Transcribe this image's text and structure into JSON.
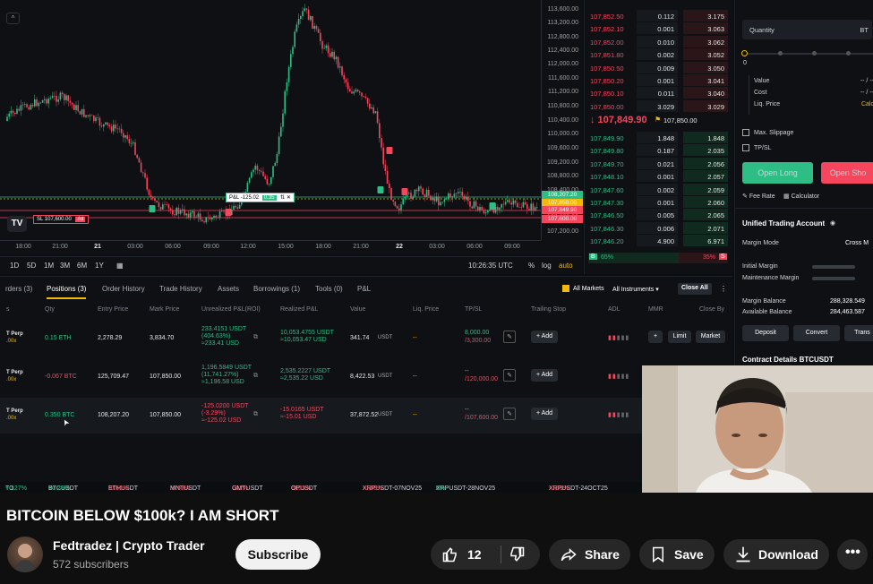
{
  "chart": {
    "y_ticks": [
      "113,600.00",
      "113,200.00",
      "112,800.00",
      "112,400.00",
      "112,000.00",
      "111,600.00",
      "111,200.00",
      "110,800.00",
      "110,400.00",
      "110,000.00",
      "109,600.00",
      "109,200.00",
      "108,800.00",
      "108,400.00",
      "107,600.00",
      "107,200.00"
    ],
    "price_tags": [
      "108,207.20",
      "107,850.00",
      "107,849.90",
      "107,600.00"
    ],
    "x_ticks": [
      "18:00",
      "21:00",
      "21",
      "03:00",
      "06:00",
      "09:00",
      "12:00",
      "15:00",
      "18:00",
      "21:00",
      "22",
      "03:00",
      "06:00",
      "09:00"
    ],
    "sl_label": "SL 107,600.00",
    "sl_all": "All",
    "pnl_label": "P&L -125.02",
    "pnl_qty": "0.35",
    "timeframes": [
      "1D",
      "5D",
      "1M",
      "3M",
      "6M",
      "1Y"
    ],
    "clock": "10:26:35 UTC",
    "opts": [
      "%",
      "log",
      "auto"
    ]
  },
  "orderbook": {
    "asks": [
      {
        "p": "107,852.50",
        "q": "0.112",
        "t": "3.175"
      },
      {
        "p": "107,852.10",
        "q": "0.001",
        "t": "3.063"
      },
      {
        "p": "107,852.00",
        "q": "0.010",
        "t": "3.062"
      },
      {
        "p": "107,851.80",
        "q": "0.002",
        "t": "3.052"
      },
      {
        "p": "107,850.50",
        "q": "0.009",
        "t": "3.050"
      },
      {
        "p": "107,850.20",
        "q": "0.001",
        "t": "3.041"
      },
      {
        "p": "107,850.10",
        "q": "0.011",
        "t": "3.040"
      },
      {
        "p": "107,850.00",
        "q": "3.029",
        "t": "3.029"
      }
    ],
    "mid_price": "↓ 107,849.90",
    "mark": "107,850.00",
    "bids": [
      {
        "p": "107,849.90",
        "q": "1.848",
        "t": "1.848"
      },
      {
        "p": "107,849.80",
        "q": "0.187",
        "t": "2.035"
      },
      {
        "p": "107,849.70",
        "q": "0.021",
        "t": "2.056"
      },
      {
        "p": "107,848.10",
        "q": "0.001",
        "t": "2.057"
      },
      {
        "p": "107,847.60",
        "q": "0.002",
        "t": "2.059"
      },
      {
        "p": "107,847.30",
        "q": "0.001",
        "t": "2.060"
      },
      {
        "p": "107,846.50",
        "q": "0.005",
        "t": "2.065"
      },
      {
        "p": "107,846.30",
        "q": "0.006",
        "t": "2.071"
      },
      {
        "p": "107,846.20",
        "q": "4.900",
        "t": "6.971"
      }
    ],
    "buy_pct": "65%",
    "sell_pct": "35%"
  },
  "trade": {
    "quantity_label": "Quantity",
    "quantity_unit": "BT",
    "slider_val": "0",
    "value_label": "Value",
    "value_val": "-- / --",
    "cost_label": "Cost",
    "cost_val": "-- / --",
    "liq_label": "Liq. Price",
    "liq_val": "Calc",
    "max_slip": "Max. Slippage",
    "tpsl": "TP/SL",
    "open_long": "Open Long",
    "open_short": "Open Sho",
    "fee_rate": "Fee Rate",
    "calculator": "Calculator",
    "uta": "Unified Trading Account",
    "margin_mode": "Margin Mode",
    "margin_mode_val": "Cross M",
    "initial_margin": "Initial Margin",
    "maint_margin": "Maintenance Margin",
    "margin_balance": "Margin Balance",
    "margin_balance_val": "288,328.549",
    "avail_balance": "Available Balance",
    "avail_balance_val": "284,463.587",
    "deposit": "Deposit",
    "convert": "Convert",
    "transfer": "Trans",
    "contract_details": "Contract Details BTCUSDT"
  },
  "positions": {
    "tabs": [
      "rders (3)",
      "Positions (3)",
      "Order History",
      "Trade History",
      "Assets",
      "Borrowings (1)",
      "Tools (0)",
      "P&L"
    ],
    "all_markets": "All Markets",
    "all_instruments": "All Instruments",
    "close_all": "Close All",
    "headers": [
      "s",
      "Qty",
      "Entry Price",
      "Mark Price",
      "Unrealized P&L(ROI)",
      "Realized P&L",
      "Value",
      "Liq. Price",
      "TP/SL",
      "Trailing Stop",
      "ADL",
      "MMR",
      "Close By"
    ],
    "rows": [
      {
        "sym": "T Perp",
        "lev": ".00x",
        "qty": "0.15 ETH",
        "entry": "2,278.29",
        "mark": "3,834.70",
        "upnl1": "233.4151 USDT",
        "upnl2": "(404.63%)",
        "upnl3": "≈233.41 USD",
        "rpnl1": "10,053.4755 USDT",
        "rpnl2": "≈10,053.47 USD",
        "value": "341.74",
        "tp": "8,000.00",
        "sl": "/3,300.00",
        "liq": "--",
        "add": "+ Add",
        "limit": "Limit",
        "market": "Market"
      },
      {
        "sym": "T Perp",
        "lev": ".00x",
        "qty": "-0.067 BTC",
        "entry": "125,709.47",
        "mark": "107,850.00",
        "upnl1": "1,196.5849 USDT",
        "upnl2": "(11,741.27%)",
        "upnl3": "≈1,196.58 USD",
        "rpnl1": "2,535.2227 USDT",
        "rpnl2": "≈2,535.22 USD",
        "value": "8,422.53",
        "tp": "--",
        "sl": "/120,000.00",
        "liq": "--",
        "add": "+ Add"
      },
      {
        "sym": "T Perp",
        "lev": ".00x",
        "qty": "0.350 BTC",
        "entry": "108,207.20",
        "mark": "107,850.00",
        "upnl1": "-125.0200 USDT",
        "upnl2": "(-3.29%)",
        "upnl3": "≈-125.02 USD",
        "rpnl1": "-15.0165 USDT",
        "rpnl2": "≈-15.01 USD",
        "value": "37,872.52",
        "tp": "--",
        "sl": "/107,600.00",
        "liq": "--",
        "add": "+ Add"
      }
    ],
    "usdt": "USDT"
  },
  "ticker": [
    {
      "n": "TO",
      "v": "+0.27%",
      "up": true
    },
    {
      "n": "BTCUSDT",
      "v": "+0.29%",
      "up": true
    },
    {
      "n": "ETHUSDT",
      "v": "-0.66%",
      "up": false
    },
    {
      "n": "MNTUSDT",
      "v": "-6.69%",
      "up": false
    },
    {
      "n": "GMTUSDT",
      "v": "-3.2%",
      "up": false
    },
    {
      "n": "OPUSDT",
      "v": "-0.55%",
      "up": false
    },
    {
      "n": "XRPUSDT-07NOV25",
      "v": "-0.68%",
      "up": false
    },
    {
      "n": "XRPUSDT-28NOV25",
      "v": "0%",
      "up": true
    },
    {
      "n": "XRPUSDT-24OCT25",
      "v": "-0.31%",
      "up": false
    }
  ],
  "youtube": {
    "title": "BITCOIN BELOW $100k? I AM SHORT",
    "channel": "Fedtradez | Crypto Trader",
    "subscribers": "572 subscribers",
    "subscribe": "Subscribe",
    "likes": "12",
    "share": "Share",
    "save": "Save",
    "download": "Download"
  },
  "colors": {
    "green": "#2ebd85",
    "red": "#f6465d",
    "yellow": "#f0b90b"
  }
}
